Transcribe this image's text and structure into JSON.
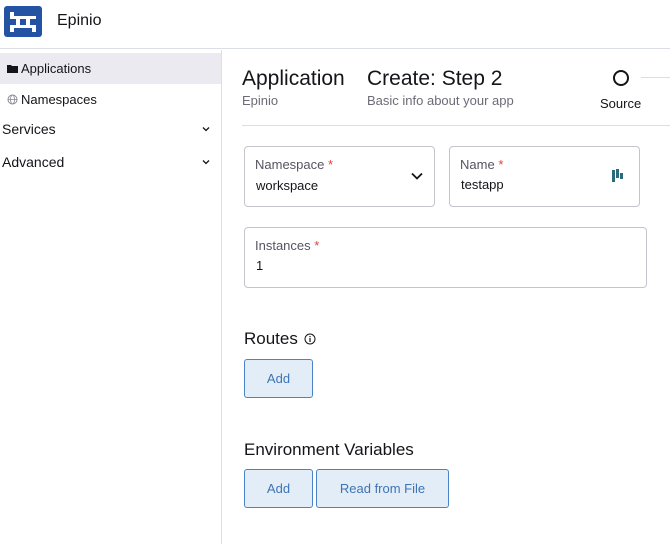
{
  "header": {
    "brand": "Epinio",
    "logo_icon": "epinio-logo-icon",
    "brand_color": "#2453a4"
  },
  "sidebar": {
    "items": [
      {
        "label": "Applications",
        "icon": "folder-icon",
        "active": true
      },
      {
        "label": "Namespaces",
        "icon": "globe-icon",
        "active": false
      }
    ],
    "groups": [
      {
        "label": "Services",
        "icon": "chevron-down-icon"
      },
      {
        "label": "Advanced",
        "icon": "chevron-down-icon"
      }
    ]
  },
  "page": {
    "title": "Application",
    "subtitle": "Epinio",
    "step_title": "Create: Step 2",
    "step_subtitle": "Basic info about your app",
    "stepper": [
      {
        "label": "Source"
      }
    ]
  },
  "form": {
    "namespace": {
      "label": "Namespace",
      "required_mark": "*",
      "value": "workspace"
    },
    "name": {
      "label": "Name",
      "required_mark": "*",
      "value": "testapp"
    },
    "instances": {
      "label": "Instances",
      "required_mark": "*",
      "value": "1"
    }
  },
  "routes": {
    "title": "Routes",
    "add_label": "Add"
  },
  "env": {
    "title": "Environment Variables",
    "add_label": "Add",
    "read_file_label": "Read from File"
  },
  "colors": {
    "accent": "#3d74b5",
    "button_bg": "#e3edf7",
    "required": "#e04040",
    "active_nav": "#eaeaf0"
  }
}
